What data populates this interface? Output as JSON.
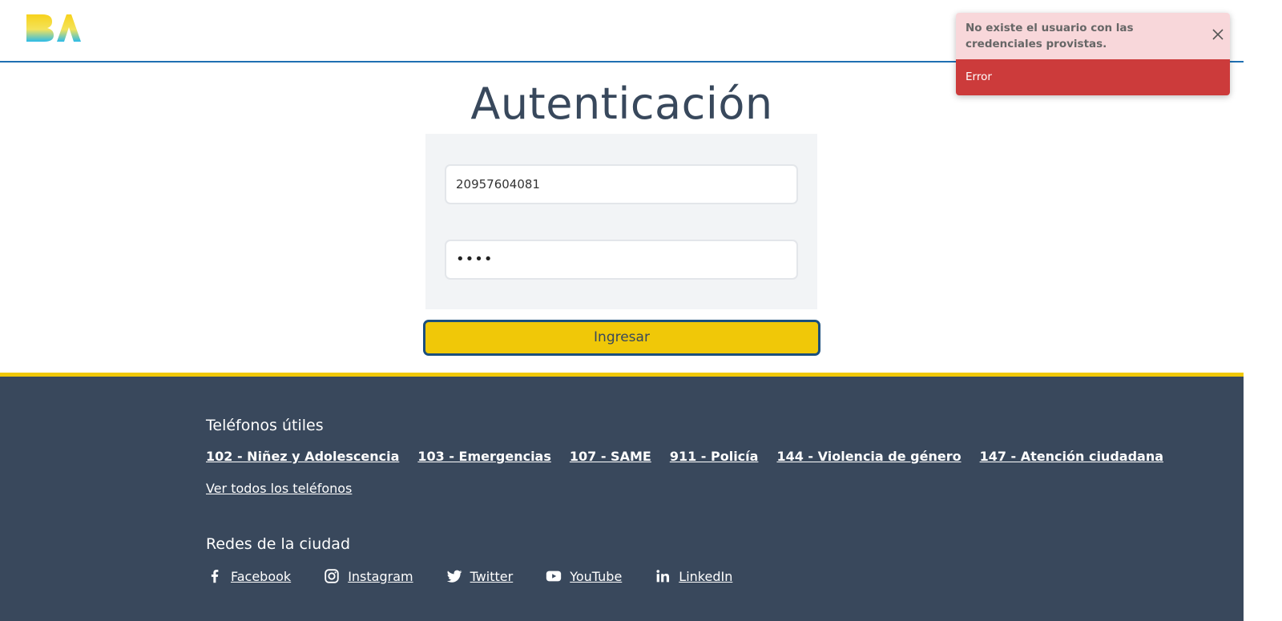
{
  "header": {
    "logo_icon": "ba-logo"
  },
  "page": {
    "title": "Autenticación"
  },
  "form": {
    "username_value": "20957604081",
    "password_value": "••••",
    "submit_label": "Ingresar"
  },
  "toast": {
    "message": "No existe el usuario con las credenciales provistas.",
    "status": "Error",
    "close_icon": "close-icon",
    "status_color": "#cc3b3b"
  },
  "footer": {
    "phones_heading": "Teléfonos útiles",
    "phone_links": [
      "102 - Niñez y Adolescencia",
      "103 - Emergencias",
      "107 - SAME",
      "911 - Policía",
      "144 - Violencia de género",
      "147 - Atención ciudadana"
    ],
    "all_phones_label": "Ver todos los teléfonos",
    "social_heading": "Redes de la ciudad",
    "social_links": [
      {
        "label": "Facebook",
        "icon": "facebook-icon"
      },
      {
        "label": "Instagram",
        "icon": "instagram-icon"
      },
      {
        "label": "Twitter",
        "icon": "twitter-icon"
      },
      {
        "label": "YouTube",
        "icon": "youtube-icon"
      },
      {
        "label": "LinkedIn",
        "icon": "linkedin-icon"
      }
    ]
  },
  "colors": {
    "accent_yellow": "#f0c808",
    "footer_bg": "#39485c",
    "header_border": "#1f6fb2"
  }
}
